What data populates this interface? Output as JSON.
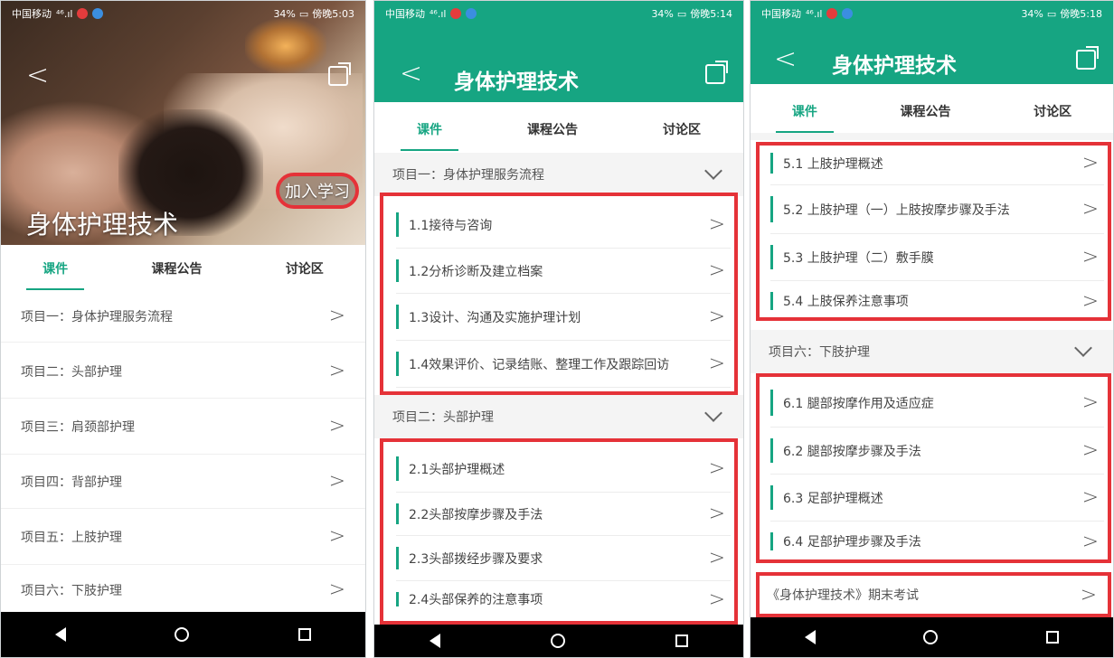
{
  "status_bar": {
    "carrier": "中国移动",
    "signal": "⁴⁶.ıl",
    "battery": "34%",
    "times": [
      "傍晚5:03",
      "傍晚5:14",
      "傍晚5:18"
    ]
  },
  "course_title": "身体护理技术",
  "join_button": "加入学习",
  "tabs": [
    "课件",
    "课程公告",
    "讨论区"
  ],
  "screen1": {
    "projects": [
      "项目一：身体护理服务流程",
      "项目二：头部护理",
      "项目三：肩颈部护理",
      "项目四：背部护理",
      "项目五：上肢护理",
      "项目六：下肢护理"
    ]
  },
  "screen2": {
    "sections": [
      {
        "title": "项目一：身体护理服务流程",
        "items": [
          "1.1接待与咨询",
          "1.2分析诊断及建立档案",
          "1.3设计、沟通及实施护理计划",
          "1.4效果评价、记录结账、整理工作及跟踪回访"
        ]
      },
      {
        "title": "项目二：头部护理",
        "items": [
          "2.1头部护理概述",
          "2.2头部按摩步骤及手法",
          "2.3头部拨经步骤及要求",
          "2.4头部保养的注意事项"
        ]
      }
    ]
  },
  "screen3": {
    "group5": [
      "5.1 上肢护理概述",
      "5.2 上肢护理（一）上肢按摩步骤及手法",
      "5.3 上肢护理（二）敷手膜",
      "5.4 上肢保养注意事项"
    ],
    "section6_title": "项目六：下肢护理",
    "group6": [
      "6.1 腿部按摩作用及适应症",
      "6.2 腿部按摩步骤及手法",
      "6.3 足部护理概述",
      "6.4 足部护理步骤及手法"
    ],
    "exam": "《身体护理技术》期末考试"
  },
  "colors": {
    "accent": "#16a582",
    "highlight": "#e53238"
  }
}
